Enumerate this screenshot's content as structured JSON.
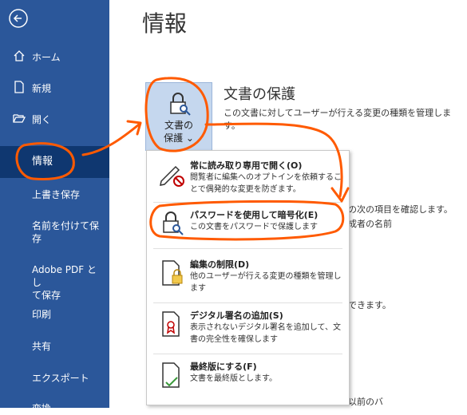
{
  "sidebar": {
    "items": [
      {
        "label": "ホーム",
        "icon": "home-icon"
      },
      {
        "label": "新規",
        "icon": "new-document-icon"
      },
      {
        "label": "開く",
        "icon": "folder-open-icon"
      }
    ],
    "selected": "情報",
    "text_items": [
      "上書き保存",
      "名前を付けて保",
      "存",
      "Adobe PDF とし",
      "て保存",
      "印刷",
      "共有",
      "エクスポート",
      "変換"
    ]
  },
  "main": {
    "title": "情報",
    "protect": {
      "line1": "文書の",
      "line2": "保護 ⌄",
      "section_title": "文書の保護",
      "section_desc": "この文書に対してユーザーが行える変更の種類を管理します。"
    },
    "bg_lines": [
      "の次の項目を確認します。",
      "成者の名前",
      "できます。",
      "以前のバ"
    ]
  },
  "menu": {
    "items": [
      {
        "title": "常に読み取り専用で開く(O)",
        "desc": "閲覧者に編集へのオプトインを依頼することで偶発的な変更を防ぎます。",
        "icon": "pencil-no-icon"
      },
      {
        "title": "パスワードを使用して暗号化(E)",
        "desc": "この文書をパスワードで保護します",
        "icon": "lock-key-icon"
      },
      {
        "title": "編集の制限(D)",
        "desc": "他のユーザーが行える変更の種類を管理します",
        "icon": "document-lock-icon"
      },
      {
        "title": "デジタル署名の追加(S)",
        "desc": "表示されないデジタル署名を追加して、文書の完全性を確保します",
        "icon": "document-ribbon-icon"
      },
      {
        "title": "最終版にする(F)",
        "desc": "文書を最終版とします。",
        "icon": "document-check-icon"
      }
    ]
  },
  "colors": {
    "sidebar": "#2b579a",
    "selected": "#0f3770",
    "annotation": "#ff5a00"
  }
}
